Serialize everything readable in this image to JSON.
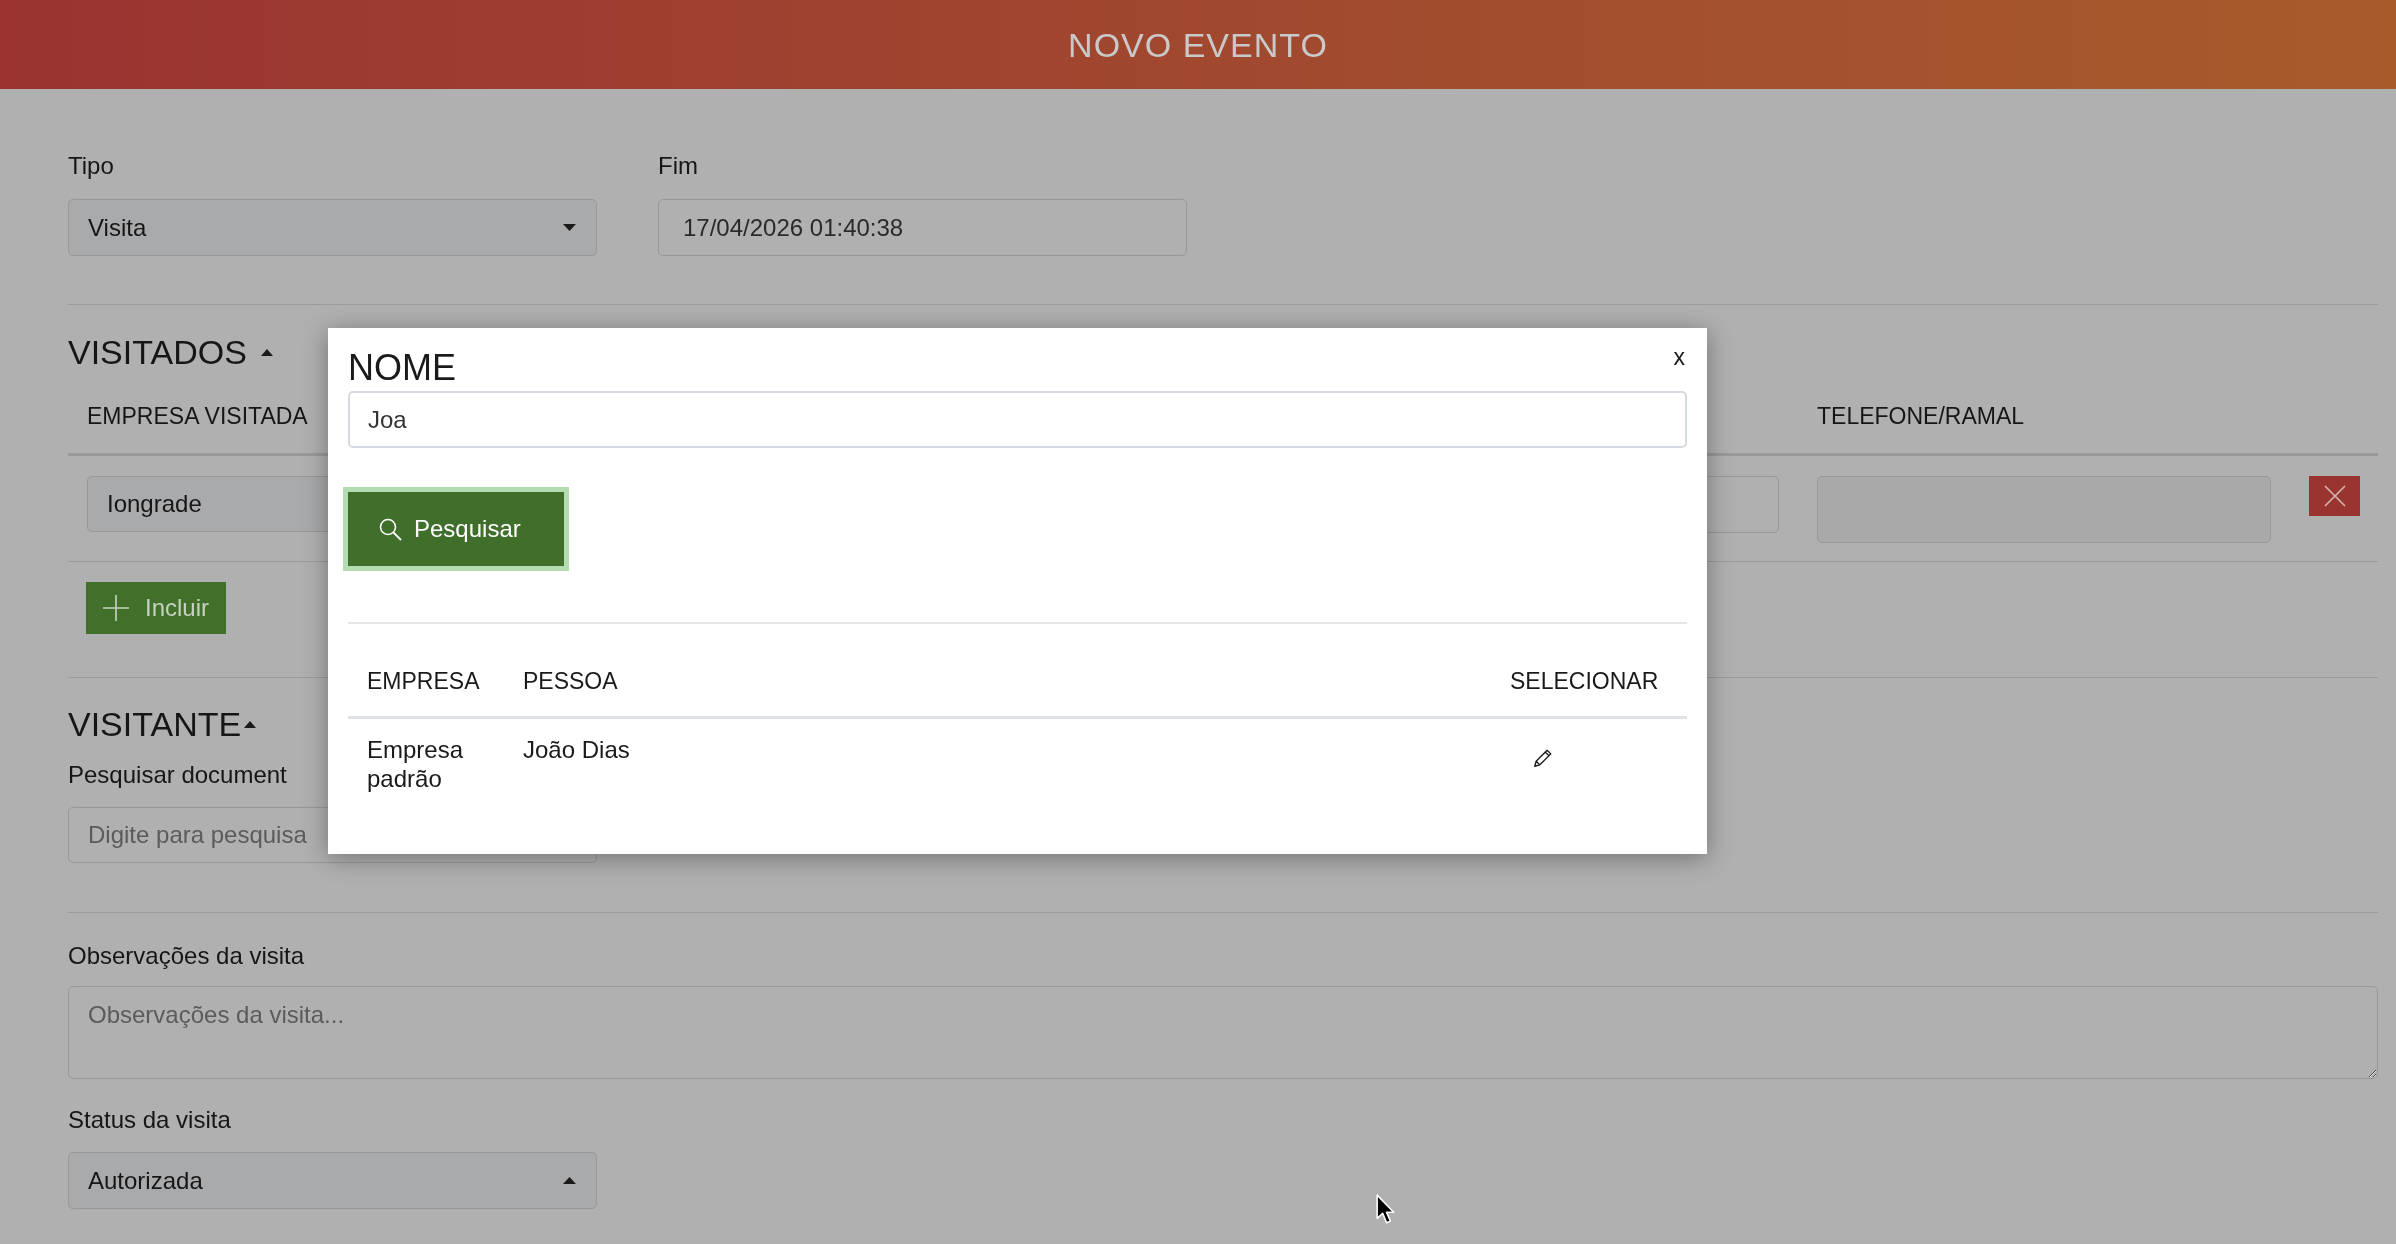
{
  "header": {
    "title": "NOVO EVENTO"
  },
  "fields": [
    {
      "kind": "select",
      "label": "Tipo",
      "value": "Visita",
      "expanded": false
    },
    {
      "kind": "input",
      "label": "Fim",
      "value": "17/04/2026 01:40:38"
    }
  ],
  "visitados": {
    "title": "VISITADOS",
    "expanded": true,
    "columns": [
      "EMPRESA VISITADA",
      "TELEFONE/RAMAL"
    ],
    "rows": [
      {
        "empresa_visitada": "Iongrade"
      }
    ],
    "add_button": "Incluir"
  },
  "visitante": {
    "title": "VISITANTE",
    "expanded": true,
    "search": {
      "label": "Pesquisar document",
      "placeholder": "Digite para pesquisa"
    }
  },
  "observacoes": {
    "label": "Observações da visita",
    "placeholder": "Observações da visita..."
  },
  "status": {
    "label": "Status da visita",
    "value": "Autorizada",
    "expanded": true
  },
  "modal": {
    "title": "NOME",
    "close": "x",
    "search_value": "Joa",
    "search_button": {
      "label": "Pesquisar",
      "focused": true
    },
    "columns": [
      "EMPRESA",
      "PESSOA",
      "SELECIONAR"
    ],
    "rows": [
      {
        "empresa": "Empresa padrão",
        "pessoa": "João Dias"
      }
    ]
  }
}
